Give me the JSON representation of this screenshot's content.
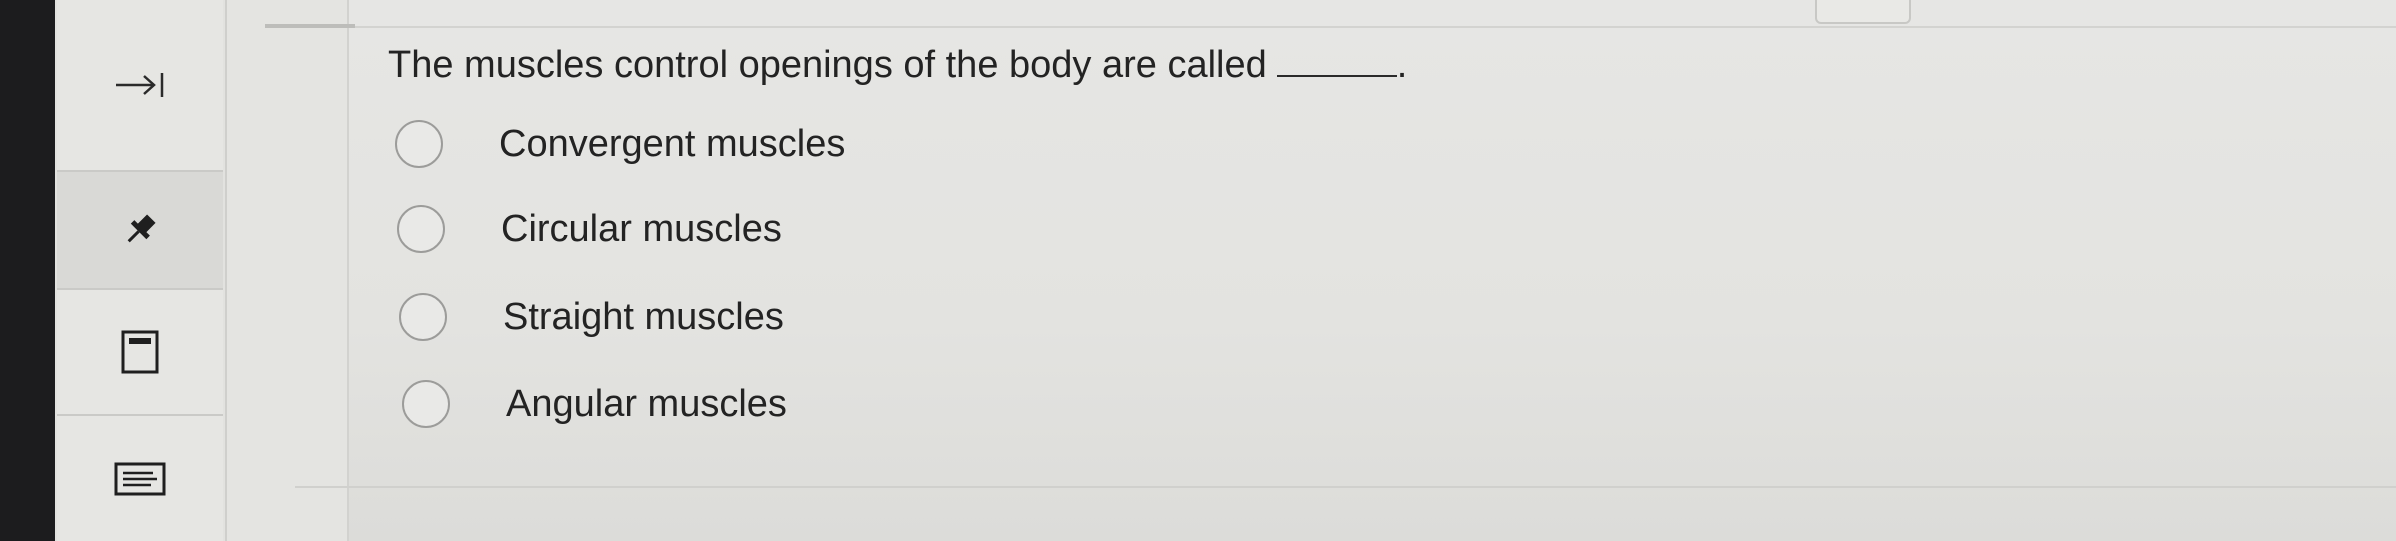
{
  "sidebar": {
    "tools": [
      {
        "icon": "collapse-arrow-icon"
      },
      {
        "icon": "pin-icon"
      },
      {
        "icon": "calculator-icon"
      },
      {
        "icon": "notes-icon"
      }
    ]
  },
  "question": {
    "text": "The muscles control openings of the body are called",
    "end_punct": "."
  },
  "options": [
    {
      "label": "Convergent muscles",
      "selected": false
    },
    {
      "label": "Circular muscles",
      "selected": false
    },
    {
      "label": "Straight muscles",
      "selected": false
    },
    {
      "label": "Angular muscles",
      "selected": false
    }
  ]
}
